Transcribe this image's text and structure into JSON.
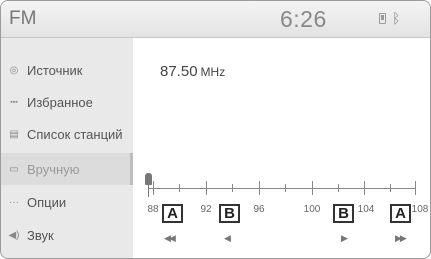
{
  "header": {
    "title": "FM",
    "clock": "6:26",
    "bluetooth_glyph": "ᛒ"
  },
  "sidebar": {
    "items": [
      {
        "label": "Источник",
        "icon": "source-icon",
        "glyph": "◎"
      },
      {
        "label": "Избранное",
        "icon": "favorites-icon",
        "glyph": "▪▪▪"
      },
      {
        "label": "Список станций",
        "icon": "station-list-icon",
        "glyph": "▤"
      },
      {
        "label": "Вручную",
        "icon": "manual-icon",
        "glyph": "▭",
        "active": true
      },
      {
        "label": "Опции",
        "icon": "options-icon",
        "glyph": "···"
      },
      {
        "label": "Звук",
        "icon": "speaker-icon",
        "glyph": "◀)"
      }
    ]
  },
  "main": {
    "frequency_value": "87.50",
    "frequency_unit": "MHz",
    "scale_labels": [
      "88",
      "92",
      "96",
      "100",
      "104",
      "108"
    ],
    "callouts": [
      "A",
      "B",
      "B",
      "A"
    ],
    "seek_glyphs": [
      "◀◀",
      "◀",
      "▶",
      "▶▶"
    ]
  },
  "colors": {
    "header_bg": "#e8e8e8",
    "sidebar_bg": "#e9e9e9",
    "active_item_bg": "#dcdcdc",
    "text": "#555555"
  }
}
